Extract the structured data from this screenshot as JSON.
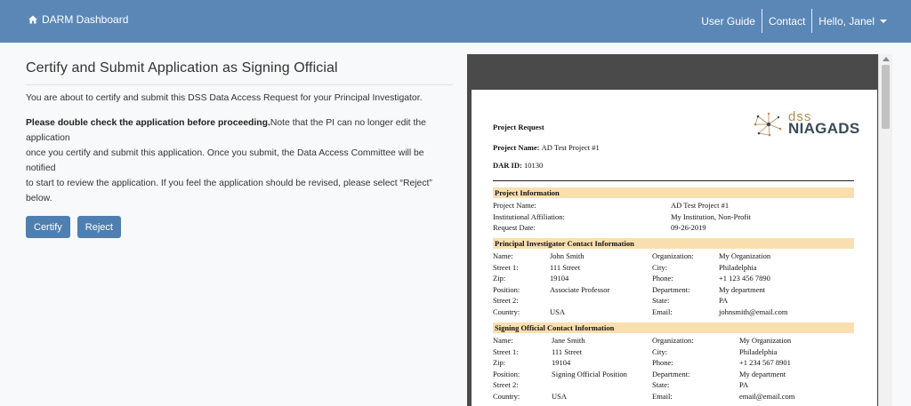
{
  "nav": {
    "brand": "DARM Dashboard",
    "links": [
      "User Guide",
      "Contact",
      "Hello, Janel"
    ]
  },
  "main": {
    "title": "Certify and Submit Application as Signing Official",
    "intro": "You are about to certify and submit this DSS Data Access Request for your Principal Investigator.",
    "warning_bold": "Please double check the application before proceeding.",
    "warning_line1": "Note that the PI can no longer edit the application",
    "warning_line2": "once you certify and submit this application. Once you submit, the Data Access Committee will be notified",
    "warning_line3": "to start to review the application. If you feel the application should be revised, please select “Reject” below.",
    "certify_label": "Certify",
    "reject_label": "Reject"
  },
  "doc": {
    "heading": "Project Request",
    "project_name_label": "Project Name",
    "project_name_value": "AD Test Project #1",
    "dar_label": "DAR ID",
    "dar_value": "10130",
    "logo_top": "dss",
    "logo_bottom": "NIAGADS",
    "project_info": {
      "title": "Project Information",
      "rows": [
        [
          "Project Name:",
          "AD Test Project #1"
        ],
        [
          "Institutional Affiliation:",
          "My Institution, Non-Profit"
        ],
        [
          "Request Date:",
          "09-26-2019"
        ]
      ]
    },
    "pi_info": {
      "title": "Principal Investigator Contact Information",
      "rows": [
        [
          "Name:",
          "John Smith",
          "Organization:",
          "My Organization"
        ],
        [
          "Street 1:",
          "111 Street",
          "City:",
          "Philadelphia"
        ],
        [
          "Zip:",
          "19104",
          "Phone:",
          "+1 123 456 7890"
        ],
        [
          "Position:",
          "Associate Professor",
          "Department:",
          "My department"
        ],
        [
          "Street 2:",
          "",
          "State:",
          "PA"
        ],
        [
          "Country:",
          "USA",
          "Email:",
          "johnsmith@email.com"
        ]
      ]
    },
    "so_info": {
      "title": "Signing Official Contact Information",
      "rows": [
        [
          "Name:",
          "Jane Smith",
          "Organization:",
          "My Organization"
        ],
        [
          "Street 1:",
          "111 Street",
          "City:",
          "Philadelphia"
        ],
        [
          "Zip:",
          "19104",
          "Phone:",
          "+1 234 567 8901"
        ],
        [
          "Position:",
          "Signing Official Position",
          "Department:",
          "My department"
        ],
        [
          "Street 2:",
          "",
          "State:",
          "PA"
        ],
        [
          "Country:",
          "USA",
          "Email:",
          "email@email.com"
        ]
      ]
    }
  }
}
